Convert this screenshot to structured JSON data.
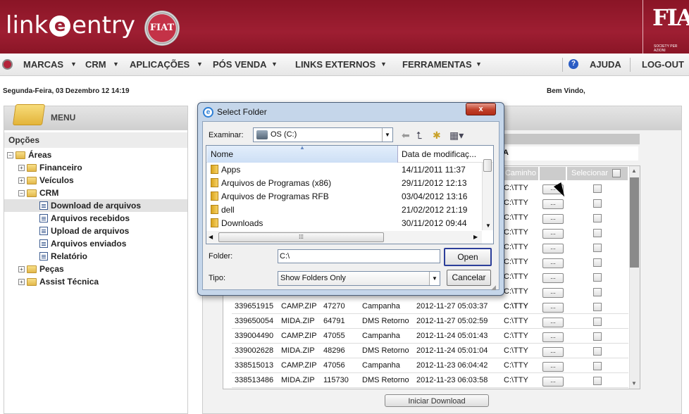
{
  "brand": {
    "logo_left": "link",
    "logo_e": "e",
    "logo_right": "entry",
    "badge": "FIAT",
    "corner_logo": "FIAT",
    "corner_tagline": "SOCIETY PER AZIONI"
  },
  "nav": {
    "items": [
      "MARCAS",
      "CRM",
      "APLICAÇÕES",
      "PÓS VENDA",
      "LINKS EXTERNOS",
      "FERRAMENTAS"
    ],
    "help": "AJUDA",
    "logout": "LOG-OUT"
  },
  "info": {
    "date": "Segunda-Feira, 03 Dezembro 12 14:19",
    "welcome": "Bem Vindo,"
  },
  "sidebar": {
    "title": "MENU",
    "section": "Opções",
    "tree": [
      {
        "label": "Áreas",
        "level": 0,
        "expanded": true,
        "type": "folder"
      },
      {
        "label": "Financeiro",
        "level": 1,
        "expanded": false,
        "type": "folder"
      },
      {
        "label": "Veículos",
        "level": 1,
        "expanded": false,
        "type": "folder"
      },
      {
        "label": "CRM",
        "level": 1,
        "expanded": true,
        "type": "folder"
      },
      {
        "label": "Download de arquivos",
        "level": 2,
        "type": "doc",
        "selected": true
      },
      {
        "label": "Arquivos recebidos",
        "level": 2,
        "type": "doc"
      },
      {
        "label": "Upload de arquivos",
        "level": 2,
        "type": "doc"
      },
      {
        "label": "Arquivos enviados",
        "level": 2,
        "type": "doc"
      },
      {
        "label": "Relatório",
        "level": 2,
        "type": "doc"
      },
      {
        "label": "Peças",
        "level": 1,
        "expanded": false,
        "type": "folder"
      },
      {
        "label": "Assist Técnica",
        "level": 1,
        "expanded": false,
        "type": "folder"
      }
    ]
  },
  "main": {
    "info_fragment": "A",
    "headers": {
      "caminho": "Caminho",
      "selecionar": "Selecionar"
    },
    "hidden_paths": [
      "C:\\TTY",
      "C:\\TTY",
      "C:\\TTY",
      "C:\\TTY",
      "C:\\TTY",
      "C:\\TTY",
      "C:\\TTY",
      "C:\\TTY",
      "C:\\TTY"
    ],
    "rows": [
      [
        "339651915",
        "CAMP.ZIP",
        "47270",
        "Campanha",
        "2012-11-27 05:03:37",
        "C:\\TTY"
      ],
      [
        "339650054",
        "MIDA.ZIP",
        "64791",
        "DMS Retorno",
        "2012-11-27 05:02:59",
        "C:\\TTY"
      ],
      [
        "339004490",
        "CAMP.ZIP",
        "47055",
        "Campanha",
        "2012-11-24 05:01:43",
        "C:\\TTY"
      ],
      [
        "339002628",
        "MIDA.ZIP",
        "48296",
        "DMS Retorno",
        "2012-11-24 05:01:04",
        "C:\\TTY"
      ],
      [
        "338515013",
        "CAMP.ZIP",
        "47056",
        "Campanha",
        "2012-11-23 06:04:42",
        "C:\\TTY"
      ],
      [
        "338513486",
        "MIDA.ZIP",
        "115730",
        "DMS Retorno",
        "2012-11-23 06:03:58",
        "C:\\TTY"
      ]
    ],
    "dots": "...",
    "start_button": "Iniciar Download"
  },
  "dialog": {
    "title": "Select Folder",
    "close": "x",
    "examinar_label": "Examinar:",
    "location": "OS (C:)",
    "col_name": "Nome",
    "col_date": "Data de modificaç...",
    "files": [
      {
        "name": "Apps",
        "date": "14/11/2011 11:37"
      },
      {
        "name": "Arquivos de Programas (x86)",
        "date": "29/11/2012 12:13"
      },
      {
        "name": "Arquivos de Programas RFB",
        "date": "03/04/2012 13:16"
      },
      {
        "name": "dell",
        "date": "21/02/2012 21:19"
      },
      {
        "name": "Downloads",
        "date": "30/11/2012 09:44"
      }
    ],
    "folder_label": "Folder:",
    "folder_value": "C:\\",
    "open": "Open",
    "tipo_label": "Tipo:",
    "tipo_value": "Show Folders Only",
    "cancel": "Cancelar"
  },
  "colors": {
    "header": "#9e1e32",
    "focus_border": "#2c3e9a"
  }
}
